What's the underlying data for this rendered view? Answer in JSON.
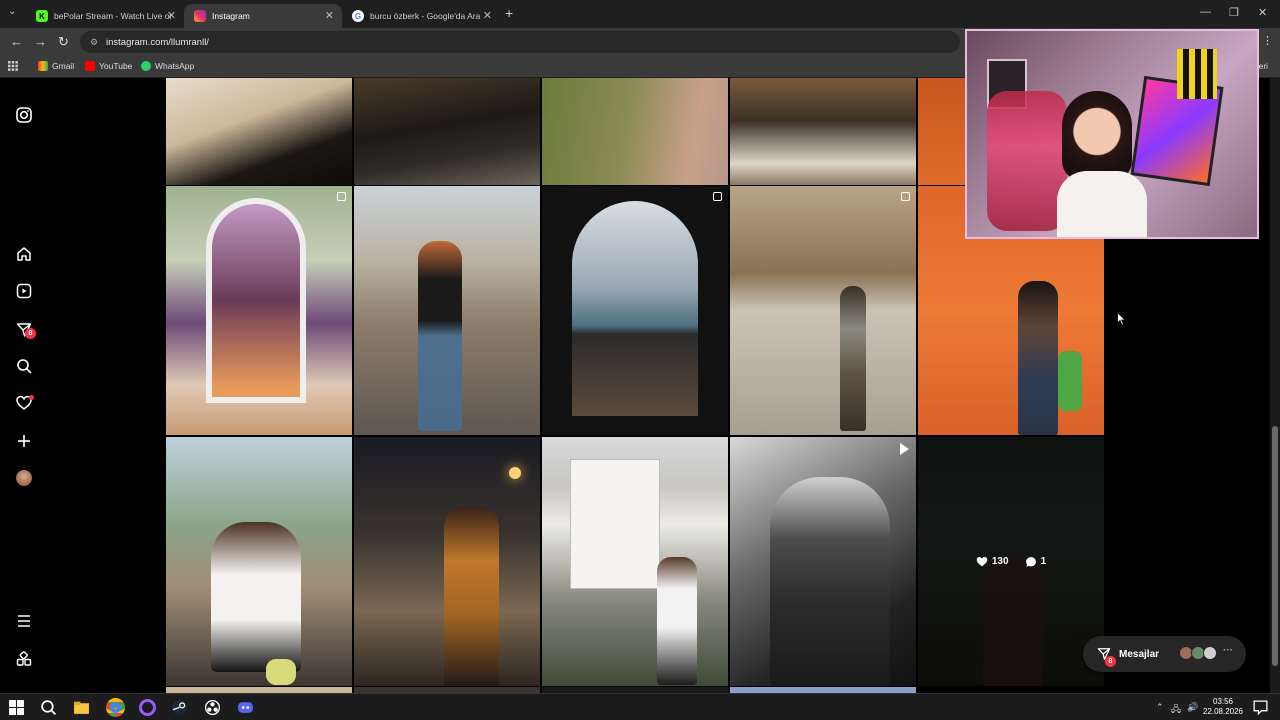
{
  "browser": {
    "tabs": [
      {
        "title": "bePolar Stream - Watch Live or",
        "favicon": "kick-icon",
        "active": false
      },
      {
        "title": "Instagram",
        "favicon": "instagram-icon",
        "active": true
      },
      {
        "title": "burcu özberk - Google'da Ara",
        "favicon": "google-icon",
        "active": false
      }
    ],
    "url": "instagram.com/llumranll/",
    "bookmarks": [
      {
        "label": "Gmail",
        "icon": "gmail-icon"
      },
      {
        "label": "YouTube",
        "icon": "youtube-icon"
      },
      {
        "label": "WhatsApp",
        "icon": "whatsapp-icon"
      }
    ],
    "bookmarks_overflow": "eleri"
  },
  "sidebar": {
    "items": [
      {
        "name": "instagram-logo-icon"
      },
      {
        "name": "home-icon"
      },
      {
        "name": "reels-icon"
      },
      {
        "name": "messages-icon",
        "badge": "8"
      },
      {
        "name": "search-icon"
      },
      {
        "name": "notifications-icon"
      },
      {
        "name": "create-icon"
      },
      {
        "name": "profile-avatar"
      },
      {
        "name": "more-menu-icon"
      },
      {
        "name": "also-from-meta-icon"
      }
    ]
  },
  "grid": {
    "hovered_post": {
      "likes": "130",
      "comments": "1"
    }
  },
  "messages_pill": {
    "label": "Mesajlar",
    "badge": "8"
  },
  "taskbar": {
    "time": "03:56",
    "date": "22.08.2026"
  },
  "colors": {
    "accent_badge": "#ff3040",
    "chrome_dark": "#1f1f1f",
    "chrome_toolbar": "#3a3a3a"
  }
}
